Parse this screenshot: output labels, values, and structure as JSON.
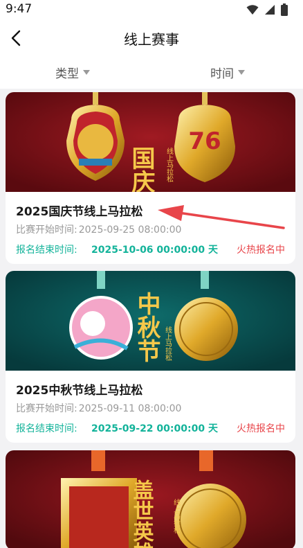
{
  "status_bar": {
    "time": "9:47"
  },
  "header": {
    "title": "线上赛事"
  },
  "filters": {
    "type_label": "类型",
    "time_label": "时间"
  },
  "icons": {
    "back": "chevron-left-icon",
    "dropdown": "caret-down-icon",
    "wifi": "wifi-icon",
    "signal": "signal-icon",
    "battery": "battery-icon"
  },
  "colors": {
    "accent_green": "#13b39a",
    "status_red": "#e8454a",
    "annotation_arrow": "#e8454a"
  },
  "events": [
    {
      "title": "2025国庆节线上马拉松",
      "start_label": "比赛开始时间:",
      "start_value": "2025-09-25 08:00:00",
      "end_label": "报名结束时间:",
      "end_value": "2025-10-06 00:00:00 天",
      "status": "火热报名中",
      "banner": {
        "medal_text": "国庆节",
        "sub_text": "线上马拉松",
        "badge_text": "76"
      }
    },
    {
      "title": "2025中秋节线上马拉松",
      "start_label": "比赛开始时间:",
      "start_value": "2025-09-11 08:00:00",
      "end_label": "报名结束时间:",
      "end_value": "2025-09-22 00:00:00 天",
      "status": "火热报名中",
      "banner": {
        "medal_text": "中秋节",
        "sub_text": "线上马拉松"
      }
    },
    {
      "banner": {
        "medal_text": "盖世英雄",
        "sub_text": "线上马拉松"
      }
    }
  ]
}
